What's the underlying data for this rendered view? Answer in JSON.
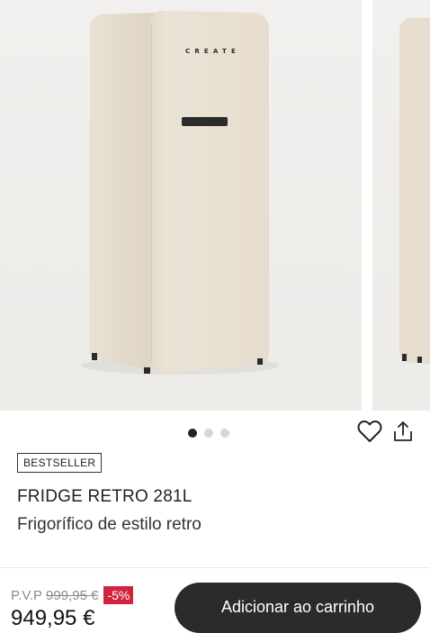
{
  "gallery": {
    "brand_text": "CREATE",
    "dots": [
      true,
      false,
      false
    ]
  },
  "icons": {
    "wishlist": "heart-icon",
    "share": "share-icon"
  },
  "product": {
    "badge": "BESTSELLER",
    "title": "FRIDGE RETRO 281L",
    "subtitle": "Frigorífico de estilo retro"
  },
  "purchase": {
    "pvp_label": "P.V.P",
    "old_price": "999,95 €",
    "discount": "-5%",
    "price": "949,95 €",
    "cart_label": "Adicionar ao carrinho"
  },
  "colors": {
    "fridge": "#e8dfd0",
    "discount": "#d2243e",
    "button": "#2b2b2b"
  }
}
